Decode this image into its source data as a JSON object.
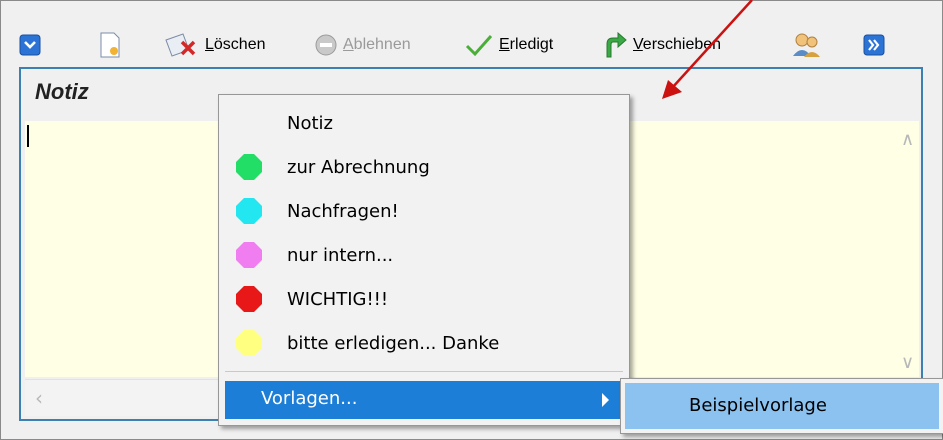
{
  "toolbar": {
    "loeschen": {
      "pre": "",
      "mnemonic": "L",
      "post": "öschen"
    },
    "ablehnen": {
      "pre": "",
      "mnemonic": "A",
      "post": "blehnen"
    },
    "erledigt": {
      "pre": "",
      "mnemonic": "E",
      "post": "rledigt"
    },
    "verschieben": {
      "pre": "",
      "mnemonic": "V",
      "post": "erschieben"
    }
  },
  "notes": {
    "title": "Notiz"
  },
  "context_menu": {
    "items": [
      {
        "label": "Notiz",
        "color": ""
      },
      {
        "label": "zur Abrechnung",
        "color": "#22dd66"
      },
      {
        "label": "Nachfragen!",
        "color": "#22e6f0"
      },
      {
        "label": "nur intern...",
        "color": "#f07ef0"
      },
      {
        "label": "WICHTIG!!!",
        "color": "#e81818"
      },
      {
        "label": "bitte erledigen... Danke",
        "color": "#ffff80"
      }
    ],
    "vorlagen": "Vorlagen...",
    "submenu_item": "Beispielvorlage"
  },
  "colors": {
    "accent": "#1c7ed6",
    "annotation_arrow": "#cc1111",
    "editor_bg": "#ffffe6",
    "panel_border": "#3c7fb1"
  },
  "icons": [
    "chevron-down-icon",
    "new-note-icon",
    "delete-icon",
    "decline-icon",
    "check-icon",
    "move-arrow-icon",
    "users-icon",
    "double-chevron-right-icon"
  ]
}
